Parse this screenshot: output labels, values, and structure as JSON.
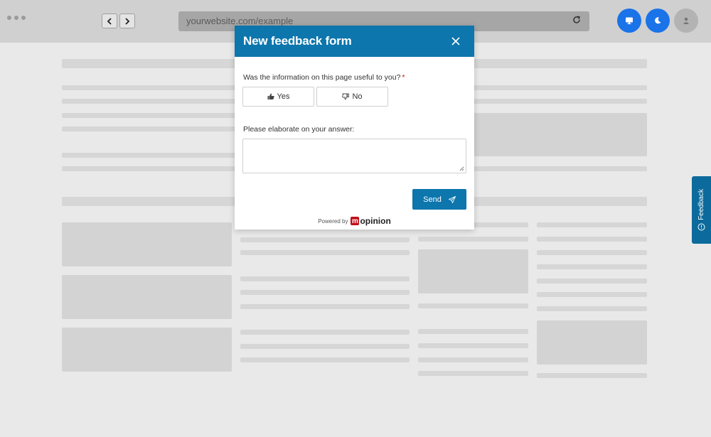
{
  "browser": {
    "url": "yourwebsite.com/example",
    "back_icon": "chevron-left-icon",
    "forward_icon": "chevron-right-icon",
    "reload_icon": "reload-icon",
    "buttons": [
      "desktop-icon",
      "moon-icon",
      "user-icon"
    ],
    "accent_color": "#1a73e8"
  },
  "modal": {
    "title": "New feedback form",
    "close_icon": "close-icon",
    "question1": {
      "label": "Was the information on this page useful to you?",
      "required_mark": "*",
      "options": [
        {
          "label": "Yes",
          "icon": "thumbs-up-icon"
        },
        {
          "label": "No",
          "icon": "thumbs-down-icon"
        }
      ]
    },
    "question2": {
      "label": "Please elaborate on your answer:",
      "value": ""
    },
    "send_label": "Send",
    "send_icon": "paper-plane-icon",
    "powered_by": "Powered by",
    "brand_name": "opinion",
    "brand_mark": "m",
    "header_color": "#0c76ad"
  },
  "feedback_tab": {
    "label": "Feedback",
    "icon": "speech-bubble-icon",
    "color": "#0c6b9c"
  }
}
